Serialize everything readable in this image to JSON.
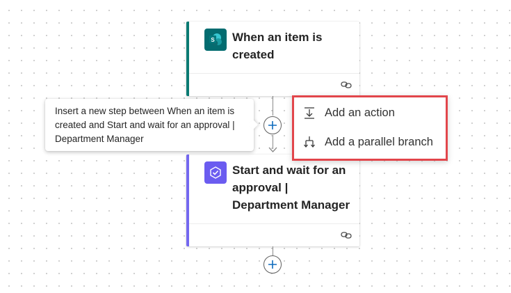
{
  "flow": {
    "trigger_card": {
      "title": "When an item is created",
      "icon": "sharepoint-icon",
      "accent_color": "#0b7b73"
    },
    "action_card": {
      "title": "Start and wait for an approval | Department Manager",
      "icon": "approvals-icon",
      "accent_color": "#7468f0"
    }
  },
  "tooltip": {
    "text": "Insert a new step between When an item is created and Start and wait for an approval | Department Manager"
  },
  "insert_menu": {
    "highlight_color": "#e2464b",
    "items": [
      {
        "label": "Add an action",
        "icon": "add-action-icon"
      },
      {
        "label": "Add a parallel branch",
        "icon": "parallel-branch-icon"
      }
    ]
  }
}
